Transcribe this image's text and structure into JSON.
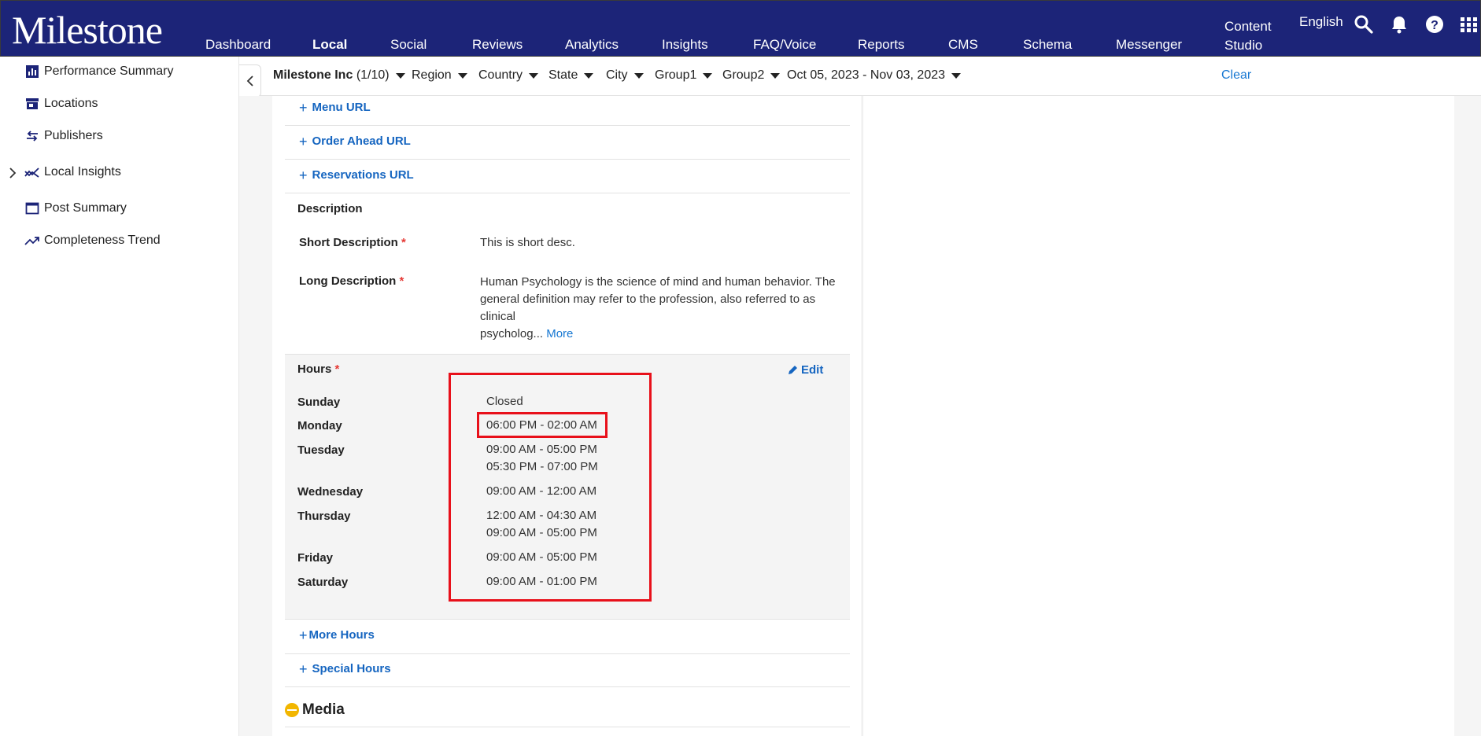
{
  "app": {
    "logo": "Milestone",
    "nav": [
      "Dashboard",
      "Local",
      "Social",
      "Reviews",
      "Analytics",
      "Insights",
      "FAQ/Voice",
      "Reports",
      "CMS",
      "Schema",
      "Messenger"
    ],
    "active_nav": "Local",
    "content_studio": [
      "Content",
      "Studio"
    ],
    "language": "English"
  },
  "sidebar": {
    "items": [
      {
        "label": "Performance Summary",
        "icon": "bar-chart-icon"
      },
      {
        "label": "Locations",
        "icon": "store-icon"
      },
      {
        "label": "Publishers",
        "icon": "swap-arrows-icon"
      },
      {
        "label": "Local Insights",
        "icon": "trend-icon"
      },
      {
        "label": "Post Summary",
        "icon": "window-icon"
      },
      {
        "label": "Completeness Trend",
        "icon": "trending-up-icon"
      }
    ]
  },
  "filters": {
    "account_name": "Milestone Inc",
    "account_count": "(1/10)",
    "region": "Region",
    "country": "Country",
    "state": "State",
    "city": "City",
    "group1": "Group1",
    "group2": "Group2",
    "date_range": "Oct 05, 2023 - Nov 03, 2023",
    "clear": "Clear"
  },
  "links": {
    "menu_url": "Menu URL",
    "order_ahead_url": "Order Ahead URL",
    "reservations_url": "Reservations URL",
    "more_hours": "More Hours",
    "special_hours": "Special Hours"
  },
  "description": {
    "heading": "Description",
    "short_label": "Short Description",
    "short_value": "This is short desc.",
    "long_label": "Long Description",
    "long_lines": [
      "Human Psychology is the science of mind and human behavior. The",
      "general definition may refer to the profession, also referred to as clinical",
      "psycholog..."
    ],
    "more": "More",
    "required_mark": "*"
  },
  "hours": {
    "heading": "Hours",
    "edit": "Edit",
    "days": [
      {
        "day": "Sunday",
        "times": [
          "Closed"
        ]
      },
      {
        "day": "Monday",
        "times": [
          "06:00 PM - 02:00 AM"
        ]
      },
      {
        "day": "Tuesday",
        "times": [
          "09:00 AM - 05:00 PM",
          "05:30 PM - 07:00 PM"
        ]
      },
      {
        "day": "Wednesday",
        "times": [
          "09:00 AM - 12:00 AM"
        ]
      },
      {
        "day": "Thursday",
        "times": [
          "12:00 AM - 04:30 AM",
          "09:00 AM - 05:00 PM"
        ]
      },
      {
        "day": "Friday",
        "times": [
          "09:00 AM - 05:00 PM"
        ]
      },
      {
        "day": "Saturday",
        "times": [
          "09:00 AM - 01:00 PM"
        ]
      }
    ]
  },
  "media": {
    "heading": "Media"
  },
  "colors": {
    "nav_bg": "#1c2478",
    "link": "#1565c0",
    "highlight": "#e8101a",
    "required": "#e53935"
  }
}
